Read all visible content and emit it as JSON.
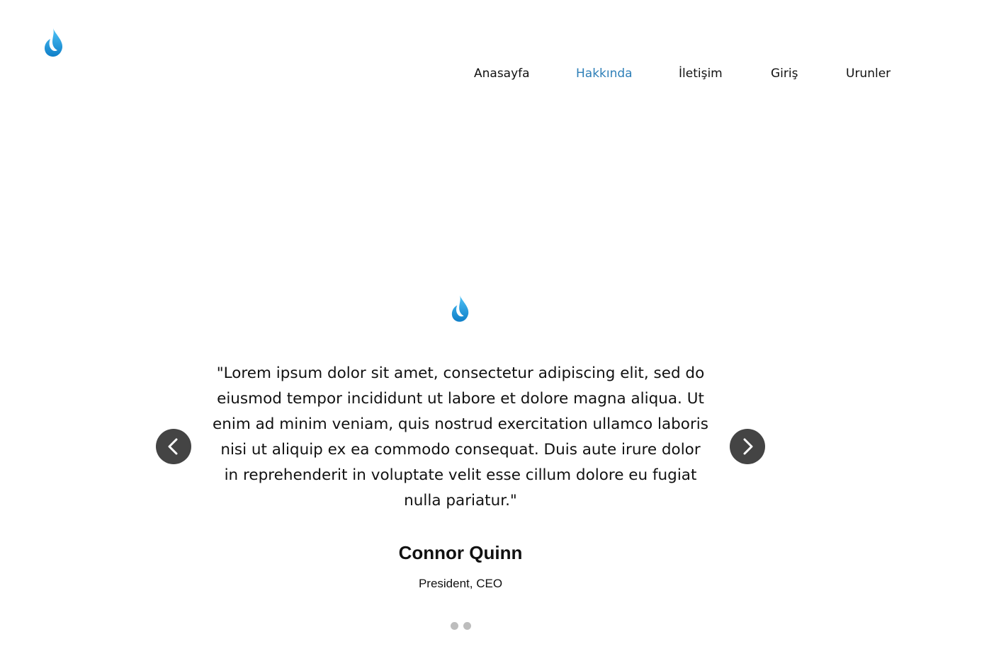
{
  "header": {
    "logo_icon": "water-drop-icon",
    "brand_color": "#0f8fd6",
    "nav": [
      {
        "label": "Anasayfa",
        "active": false
      },
      {
        "label": "Hakkında",
        "active": true
      },
      {
        "label": "İletişim",
        "active": false
      },
      {
        "label": "Giriş",
        "active": false
      },
      {
        "label": "Urunler",
        "active": false
      }
    ],
    "active_color": "#2e7fb8"
  },
  "testimonial": {
    "icon": "water-drop-icon",
    "quote": "\"Lorem ipsum dolor sit amet, consectetur adipiscing elit, sed do eiusmod tempor incididunt ut labore et dolore magna aliqua. Ut enim ad minim veniam, quis nostrud exercitation ullamco laboris nisi ut aliquip ex ea commodo consequat. Duis aute irure dolor in reprehenderit in voluptate velit esse cillum dolore eu fugiat nulla pariatur.\"",
    "author": "Connor Quinn",
    "role": "President, CEO",
    "prev_icon": "chevron-left-icon",
    "next_icon": "chevron-right-icon",
    "arrow_color": "#444444",
    "slides_count": 2,
    "dot_color": "#bdbdbd"
  }
}
